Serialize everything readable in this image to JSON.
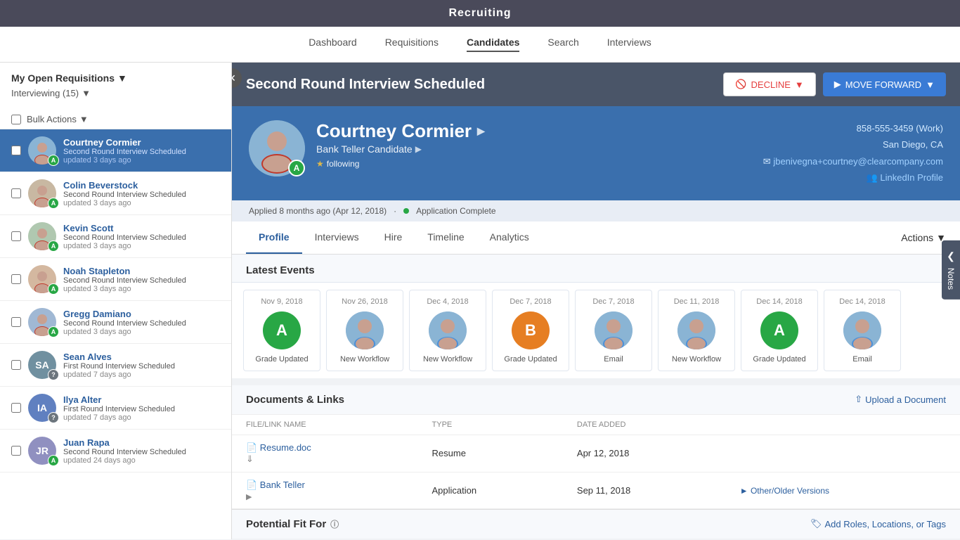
{
  "app": {
    "title": "Recruiting"
  },
  "nav": {
    "items": [
      {
        "label": "Dashboard",
        "active": false
      },
      {
        "label": "Requisitions",
        "active": false
      },
      {
        "label": "Candidates",
        "active": true
      },
      {
        "label": "Search",
        "active": false
      },
      {
        "label": "Interviews",
        "active": false
      }
    ]
  },
  "sidebar": {
    "title": "My Open Requisitions",
    "subtitle": "Interviewing (15)",
    "bulk_actions_label": "Bulk Actions",
    "candidates": [
      {
        "name": "Courtney Cormier",
        "status": "Second Round Interview Scheduled",
        "updated": "updated 3 days ago",
        "grade": "A",
        "grade_class": "grade-a",
        "active": true,
        "color": "#8ab4d4"
      },
      {
        "name": "Colin Beverstock",
        "status": "Second Round Interview Scheduled",
        "updated": "updated 3 days ago",
        "grade": "A",
        "grade_class": "grade-a",
        "active": false,
        "color": "#c8b8a2"
      },
      {
        "name": "Kevin Scott",
        "status": "Second Round Interview Scheduled",
        "updated": "updated 3 days ago",
        "grade": "A",
        "grade_class": "grade-a",
        "active": false,
        "color": "#b0c8b0"
      },
      {
        "name": "Noah Stapleton",
        "status": "Second Round Interview Scheduled",
        "updated": "updated 3 days ago",
        "grade": "A",
        "grade_class": "grade-a",
        "active": false,
        "color": "#d4b8a0"
      },
      {
        "name": "Gregg Damiano",
        "status": "Second Round Interview Scheduled",
        "updated": "updated 3 days ago",
        "grade": "A",
        "grade_class": "grade-a",
        "active": false,
        "color": "#a0b8d4"
      },
      {
        "name": "Sean Alves",
        "status": "First Round Interview Scheduled",
        "updated": "updated 7 days ago",
        "grade": "?",
        "grade_class": "grade-q",
        "active": false,
        "initials": "SA",
        "color": "#7090a0"
      },
      {
        "name": "Ilya Alter",
        "status": "First Round Interview Scheduled",
        "updated": "updated 7 days ago",
        "grade": "?",
        "grade_class": "grade-q",
        "active": false,
        "initials": "IA",
        "color": "#6080c0"
      },
      {
        "name": "Juan Rapa",
        "status": "Second Round Interview Scheduled",
        "updated": "updated 24 days ago",
        "grade": "A",
        "grade_class": "grade-a",
        "active": false,
        "initials": "JR",
        "color": "#9090c0"
      }
    ]
  },
  "candidate_detail": {
    "status_title": "Second Round Interview Scheduled",
    "decline_label": "DECLINE",
    "move_forward_label": "MOVE FORWARD",
    "name": "Courtney Cormier",
    "role": "Bank Teller Candidate",
    "following": "following",
    "phone": "858-555-3459 (Work)",
    "location": "San Diego, CA",
    "email": "jbenivegna+courtney@clearcompany.com",
    "linkedin": "LinkedIn Profile",
    "applied_text": "Applied 8 months ago (Apr 12, 2018)",
    "app_status": "Application Complete",
    "tabs": [
      {
        "label": "Profile",
        "active": true
      },
      {
        "label": "Interviews",
        "active": false
      },
      {
        "label": "Hire",
        "active": false
      },
      {
        "label": "Timeline",
        "active": false
      },
      {
        "label": "Analytics",
        "active": false
      }
    ],
    "actions_label": "Actions",
    "latest_events_title": "Latest Events",
    "events": [
      {
        "date": "Nov 9, 2018",
        "type": "Grade Updated",
        "avatar_type": "letter",
        "letter": "A",
        "color": "#28a745"
      },
      {
        "date": "Nov 26, 2018",
        "type": "New Workflow",
        "avatar_type": "photo",
        "color": "#8ab4d4"
      },
      {
        "date": "Dec 4, 2018",
        "type": "New Workflow",
        "avatar_type": "photo",
        "color": "#8ab4d4"
      },
      {
        "date": "Dec 7, 2018",
        "type": "Grade Updated",
        "avatar_type": "letter",
        "letter": "B",
        "color": "#e67e22"
      },
      {
        "date": "Dec 7, 2018",
        "type": "Email",
        "avatar_type": "photo",
        "color": "#8ab4d4"
      },
      {
        "date": "Dec 11, 2018",
        "type": "New Workflow",
        "avatar_type": "photo",
        "color": "#8ab4d4"
      },
      {
        "date": "Dec 14, 2018",
        "type": "Grade Updated",
        "avatar_type": "letter",
        "letter": "A",
        "color": "#28a745"
      },
      {
        "date": "Dec 14, 2018",
        "type": "Email",
        "avatar_type": "photo",
        "color": "#8ab4d4"
      }
    ],
    "documents_title": "Documents & Links",
    "upload_label": "Upload a Document",
    "doc_columns": [
      "FILE/LINK NAME",
      "TYPE",
      "DATE ADDED"
    ],
    "documents": [
      {
        "name": "Resume.doc",
        "type": "Resume",
        "date": "Apr 12, 2018",
        "has_download": true,
        "has_link": false
      },
      {
        "name": "Bank Teller",
        "type": "Application",
        "date": "Sep 11, 2018",
        "has_download": false,
        "has_link": true,
        "other_versions": "Other/Older Versions"
      }
    ],
    "potential_fit_title": "Potential Fit For",
    "add_roles_label": "Add Roles, Locations, or Tags",
    "notes_label": "Notes"
  }
}
